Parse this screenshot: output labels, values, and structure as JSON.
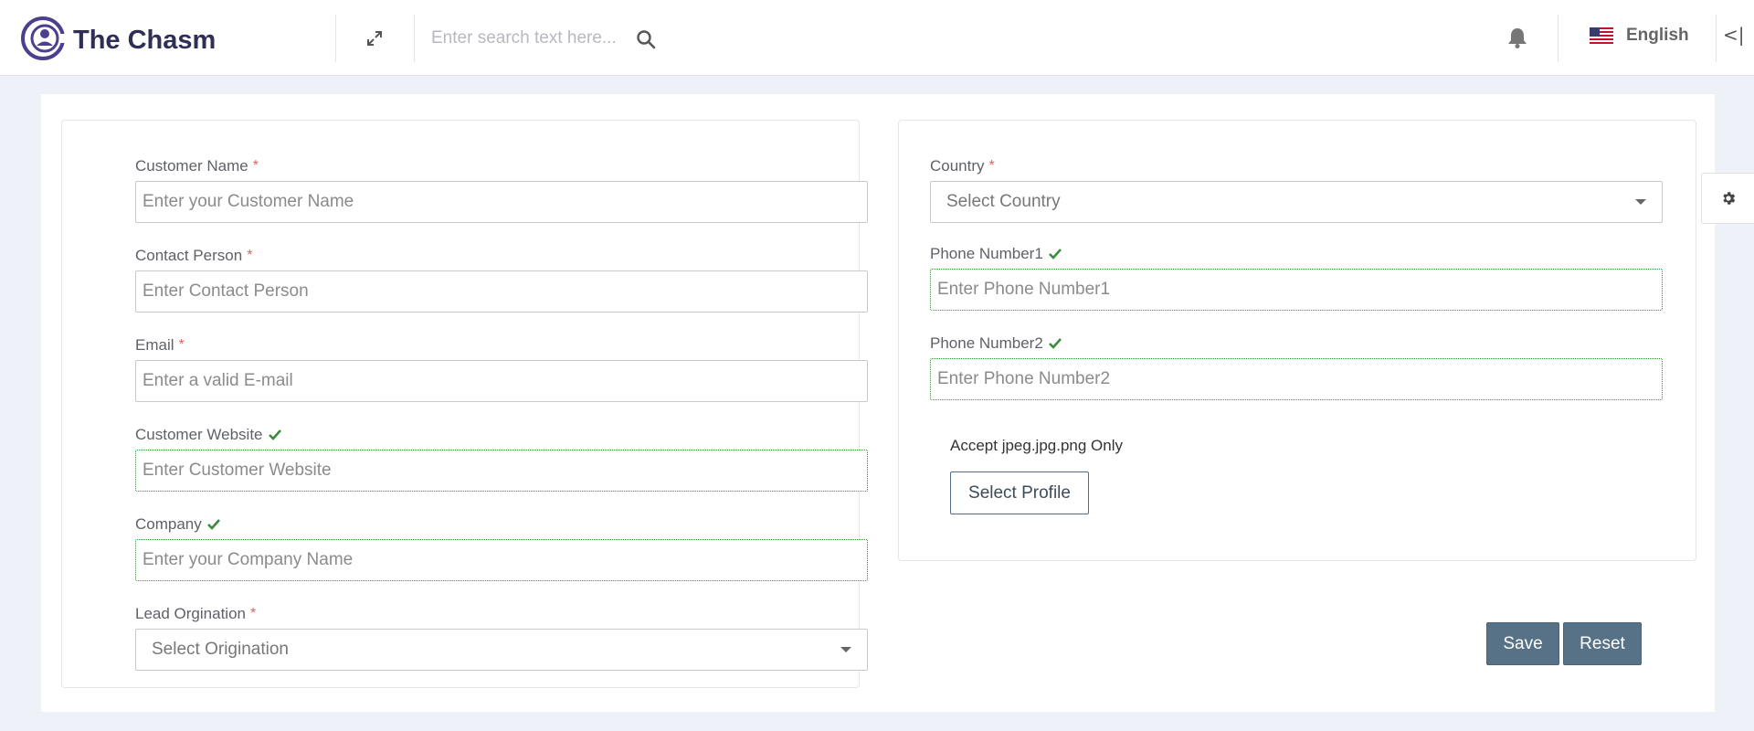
{
  "header": {
    "brand": "The Chasm",
    "search_placeholder": "Enter search text here...",
    "language": "English",
    "collapse_label": "<|"
  },
  "form_left": {
    "customer_name": {
      "label": "Customer Name",
      "required_mark": "*",
      "placeholder": "Enter your Customer Name"
    },
    "contact_person": {
      "label": "Contact Person",
      "required_mark": "*",
      "placeholder": "Enter Contact Person"
    },
    "email": {
      "label": "Email",
      "required_mark": "*",
      "placeholder": "Enter a valid E-mail"
    },
    "customer_website": {
      "label": "Customer Website",
      "placeholder": "Enter Customer Website"
    },
    "company": {
      "label": "Company",
      "placeholder": "Enter your Company Name"
    },
    "lead_origination": {
      "label": "Lead Orgination",
      "required_mark": "*",
      "selected": "Select Origination"
    }
  },
  "form_right": {
    "country": {
      "label": "Country",
      "required_mark": "*",
      "selected": "Select Country"
    },
    "phone1": {
      "label": "Phone Number1",
      "placeholder": "Enter Phone Number1"
    },
    "phone2": {
      "label": "Phone Number2",
      "placeholder": "Enter Phone Number2"
    },
    "accept_note": "Accept jpeg.jpg.png Only",
    "select_profile_label": "Select Profile"
  },
  "actions": {
    "save_label": "Save",
    "reset_label": "Reset"
  },
  "colors": {
    "brand": "#4b3f8e",
    "valid_check": "#3c8a3c",
    "required": "#e8605a",
    "action_button": "#577287"
  },
  "icons": [
    "expand-icon",
    "search-icon",
    "bell-icon",
    "us-flag-icon",
    "check-icon",
    "chevron-down-icon",
    "gear-icon"
  ]
}
